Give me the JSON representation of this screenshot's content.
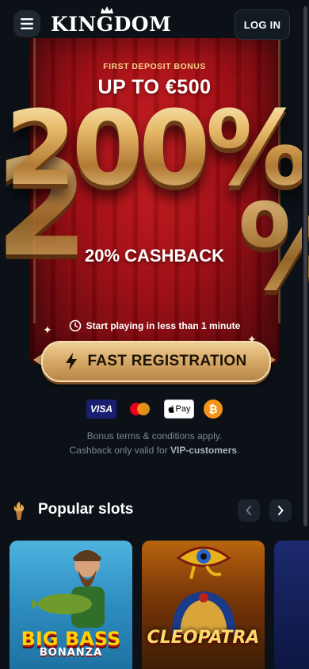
{
  "header": {
    "logo_text": "KINGDOM",
    "login_label": "LOG IN",
    "menu_icon": "hamburger-icon"
  },
  "hero": {
    "bonus_label": "FIRST DEPOSIT BONUS",
    "bonus_amount": "UP TO €500",
    "percent": "200%",
    "cashback": "20% CASHBACK",
    "start_text": "Start playing in less than 1 minute",
    "register_label": "FAST REGISTRATION",
    "colors": {
      "banner_red": "#9e0c12",
      "gold": "#d6a866"
    }
  },
  "payments": {
    "items": [
      {
        "name": "visa",
        "label": "VISA"
      },
      {
        "name": "mastercard",
        "label": ""
      },
      {
        "name": "apple-pay",
        "label": "Pay"
      },
      {
        "name": "bitcoin",
        "label": "₿"
      }
    ]
  },
  "terms": {
    "line1": "Bonus terms & conditions apply.",
    "line2_prefix": "Cashback only valid for ",
    "line2_bold": "VIP-customers",
    "line2_suffix": "."
  },
  "popular": {
    "title": "Popular slots",
    "prev_icon": "chevron-left-icon",
    "next_icon": "chevron-right-icon",
    "slots": [
      {
        "title_line1": "BIG BASS",
        "title_line2": "BONANZA"
      },
      {
        "title_line1": "CLEOPATRA"
      }
    ]
  }
}
